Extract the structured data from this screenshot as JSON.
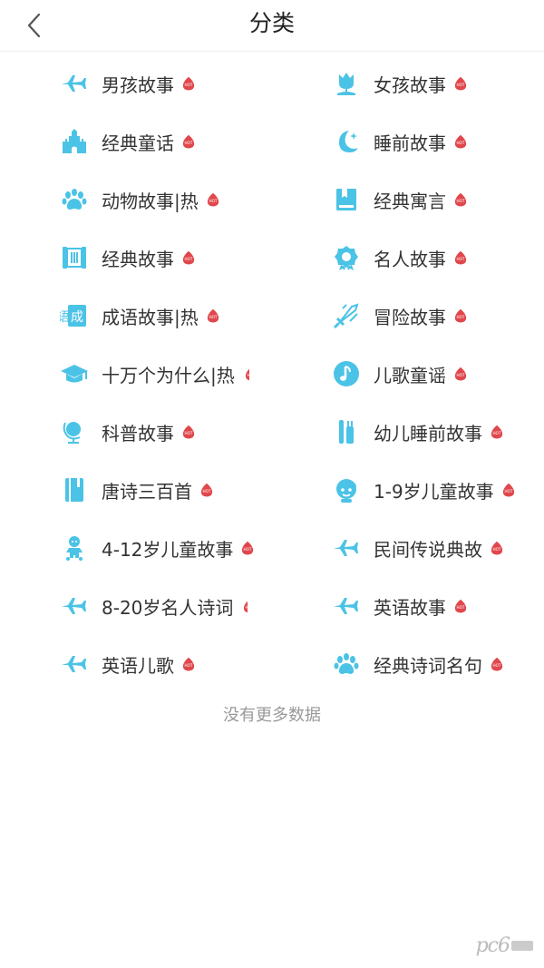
{
  "header": {
    "title": "分类"
  },
  "colors": {
    "accent": "#4bc3e6",
    "hot": "#e0474c",
    "muted": "#999999"
  },
  "categories": [
    {
      "label": "男孩故事",
      "icon": "airplane-icon",
      "hot": true
    },
    {
      "label": "女孩故事",
      "icon": "tulip-icon",
      "hot": true
    },
    {
      "label": "经典童话",
      "icon": "castle-icon",
      "hot": true
    },
    {
      "label": "睡前故事",
      "icon": "moon-icon",
      "hot": true
    },
    {
      "label": "动物故事|热",
      "icon": "paw-icon",
      "hot": true
    },
    {
      "label": "经典寓言",
      "icon": "book-icon",
      "hot": true
    },
    {
      "label": "经典故事",
      "icon": "scroll-icon",
      "hot": true
    },
    {
      "label": "名人故事",
      "icon": "award-icon",
      "hot": true
    },
    {
      "label": "成语故事|热",
      "icon": "idiom-icon",
      "hot": true
    },
    {
      "label": "冒险故事",
      "icon": "sword-icon",
      "hot": true
    },
    {
      "label": "十万个为什么|热",
      "icon": "graduation-cap-icon",
      "hot": true,
      "clip": true
    },
    {
      "label": "儿歌童谣",
      "icon": "music-note-icon",
      "hot": true
    },
    {
      "label": "科普故事",
      "icon": "globe-icon",
      "hot": true
    },
    {
      "label": "幼儿睡前故事",
      "icon": "toothbrush-icon",
      "hot": true
    },
    {
      "label": "唐诗三百首",
      "icon": "notebook-icon",
      "hot": true
    },
    {
      "label": "1-9岁儿童故事",
      "icon": "kid-face-icon",
      "hot": true
    },
    {
      "label": "4-12岁儿童故事",
      "icon": "baby-icon",
      "hot": true
    },
    {
      "label": "民间传说典故",
      "icon": "airplane-icon",
      "hot": true
    },
    {
      "label": "8-20岁名人诗词",
      "icon": "airplane-icon",
      "hot": true,
      "clip": true
    },
    {
      "label": "英语故事",
      "icon": "airplane-icon",
      "hot": true
    },
    {
      "label": "英语儿歌",
      "icon": "airplane-icon",
      "hot": true
    },
    {
      "label": "经典诗词名句",
      "icon": "paw-icon",
      "hot": true
    }
  ],
  "footer": {
    "no_more": "没有更多数据"
  }
}
